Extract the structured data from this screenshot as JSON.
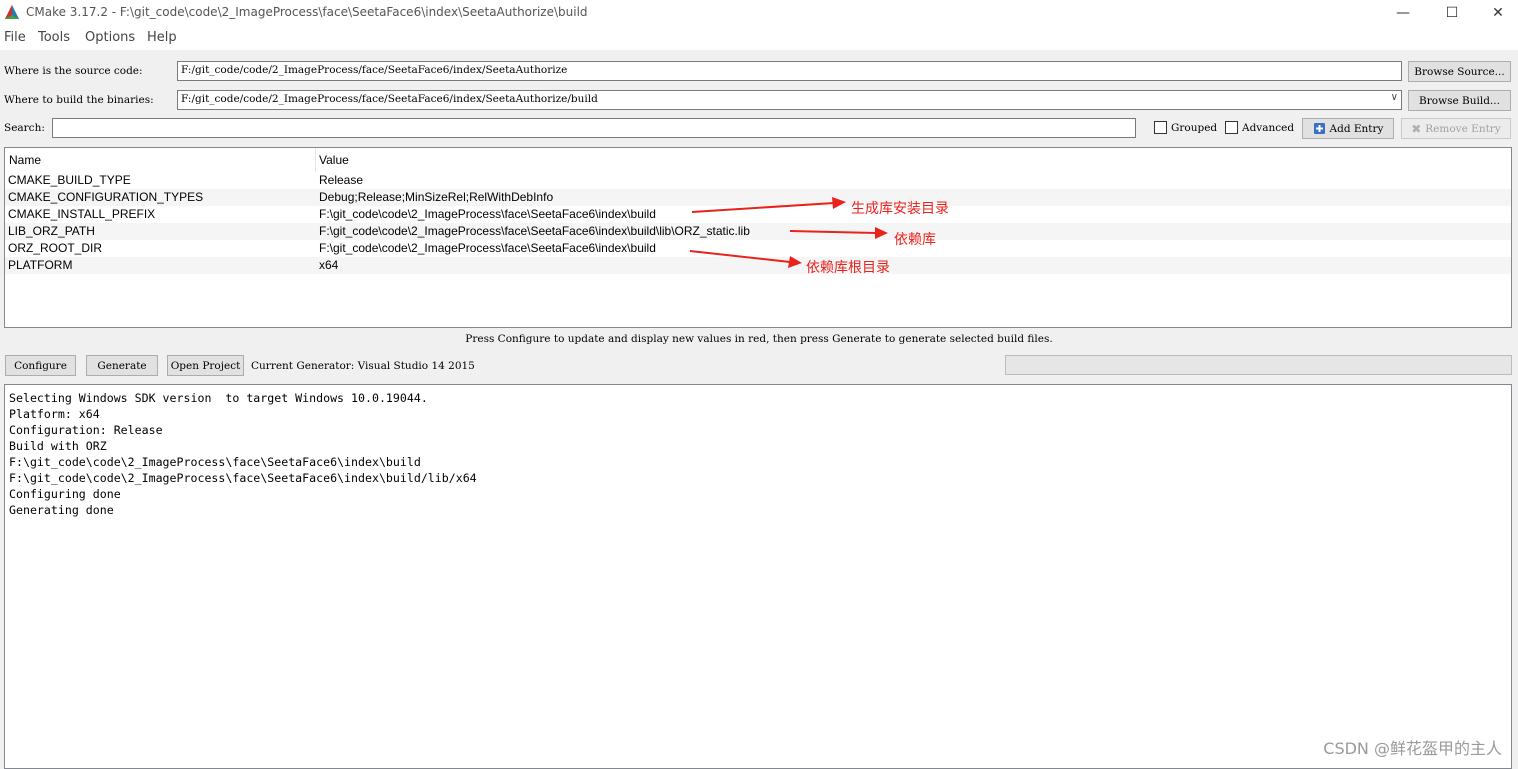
{
  "window": {
    "title": "CMake 3.17.2 - F:\\git_code\\code\\2_ImageProcess\\face\\SeetaFace6\\index\\SeetaAuthorize\\build",
    "minimize": "—",
    "maximize": "☐",
    "close": "✕"
  },
  "menu": [
    "File",
    "Tools",
    "Options",
    "Help"
  ],
  "source": {
    "label": "Where is the source code:",
    "value": "F:/git_code/code/2_ImageProcess/face/SeetaFace6/index/SeetaAuthorize",
    "browse_label": "Browse Source..."
  },
  "build": {
    "label": "Where to build the binaries:",
    "value": "F:/git_code/code/2_ImageProcess/face/SeetaFace6/index/SeetaAuthorize/build",
    "browse_label": "Browse Build..."
  },
  "search": {
    "label": "Search:",
    "value": "",
    "grouped_label": "Grouped",
    "advanced_label": "Advanced",
    "add_entry_label": "Add Entry",
    "remove_entry_label": "Remove Entry"
  },
  "grid": {
    "headers": [
      "Name",
      "Value"
    ],
    "rows": [
      {
        "name": "CMAKE_BUILD_TYPE",
        "value": "Release"
      },
      {
        "name": "CMAKE_CONFIGURATION_TYPES",
        "value": "Debug;Release;MinSizeRel;RelWithDebInfo"
      },
      {
        "name": "CMAKE_INSTALL_PREFIX",
        "value": "F:\\git_code\\code\\2_ImageProcess\\face\\SeetaFace6\\index\\build"
      },
      {
        "name": "LIB_ORZ_PATH",
        "value": "F:\\git_code\\code\\2_ImageProcess\\face\\SeetaFace6\\index\\build\\lib\\ORZ_static.lib"
      },
      {
        "name": "ORZ_ROOT_DIR",
        "value": "F:\\git_code\\code\\2_ImageProcess\\face\\SeetaFace6\\index\\build"
      },
      {
        "name": "PLATFORM",
        "value": "x64"
      }
    ]
  },
  "hint": "Press Configure to update and display new values in red, then press Generate to generate selected build files.",
  "actions": {
    "configure": "Configure",
    "generate": "Generate",
    "open_project": "Open Project",
    "generator": "Current Generator: Visual Studio 14 2015"
  },
  "output": [
    "Selecting Windows SDK version  to target Windows 10.0.19044.",
    "Platform: x64",
    "Configuration: Release",
    "Build with ORZ",
    "F:\\git_code\\code\\2_ImageProcess\\face\\SeetaFace6\\index\\build",
    "F:\\git_code\\code\\2_ImageProcess\\face\\SeetaFace6\\index\\build/lib/x64",
    "Configuring done",
    "Generating done"
  ],
  "annotations": {
    "install_dir": "生成库安装目录",
    "dependency": "依赖库",
    "dependency_root": "依赖库根目录",
    "color": "#e8231e"
  },
  "watermark": "CSDN @鲜花盔甲的主人"
}
